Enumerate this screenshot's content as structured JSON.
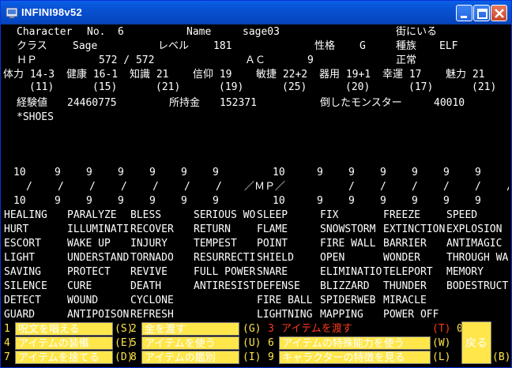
{
  "window": {
    "title": "INFINI98v52"
  },
  "char": {
    "row1": [
      "Character",
      "No.",
      "6",
      "Name",
      "sage03",
      "街にいる"
    ],
    "row2": [
      "クラス",
      "Sage",
      "レベル",
      "181",
      "性格",
      "G",
      "種族",
      "ELF"
    ],
    "row3": [
      "ＨＰ",
      "572 / 572",
      "ＡＣ",
      "9",
      "正常"
    ],
    "stats": [
      "体力 14-3",
      "健康 16-1",
      "知識 21",
      "信仰 19",
      "敏捷 22+2",
      "器用 19+1",
      "幸運 17",
      "魅力 21"
    ],
    "stats_sub": [
      "(11)",
      "(15)",
      "(21)",
      "(19)",
      "(25)",
      "(20)",
      "(17)",
      "(21)"
    ],
    "exp_label": "経験値",
    "exp": "24460775",
    "gold_label": "所持金",
    "gold": "152371",
    "kills_label": "倒したモンスター",
    "kills": "40010",
    "equip": "*SHOES"
  },
  "mp": {
    "top": [
      "10",
      "9",
      "9",
      "9",
      "9",
      "9",
      "9",
      "10",
      "9",
      "9",
      "9",
      "9",
      "9",
      "9"
    ],
    "slash_label": "／ＭＰ／",
    "bottom": [
      "10",
      "9",
      "9",
      "9",
      "9",
      "9",
      "9",
      "10",
      "9",
      "9",
      "9",
      "9",
      "9",
      "9"
    ]
  },
  "spells": [
    [
      "HEALING",
      "PARALYZE",
      "BLESS",
      "SERIOUS WO",
      "SLEEP",
      "FIX",
      "FREEZE",
      "SPEED"
    ],
    [
      "HURT",
      "ILLUMINATI",
      "RECOVER",
      "RETURN",
      "FLAME",
      "SNOWSTORM",
      "EXTINCTION",
      "EXPLOSION"
    ],
    [
      "ESCORT",
      "WAKE UP",
      "INJURY",
      "TEMPEST",
      "POINT",
      "FIRE WALL",
      "BARRIER",
      "ANTIMAGIC"
    ],
    [
      "LIGHT",
      "UNDERSTAND",
      "TORNADO",
      "RESURRECTI",
      "SHIELD",
      "OPEN",
      "WONDER",
      "THROUGH WA"
    ],
    [
      "SAVING",
      "PROTECT",
      "REVIVE",
      "FULL POWER",
      "SNARE",
      "ELIMINATIO",
      "TELEPORT",
      "MEMORY"
    ],
    [
      "SILENCE",
      "CURE",
      "DEATH",
      "ANTIRESIST",
      "DEFENSE",
      "BLIZZARD",
      "THUNDER",
      "BODESTRUCTIO"
    ],
    [
      "DETECT",
      "WOUND",
      "CYCLONE",
      "",
      "FIRE BALL",
      "SPIDERWEB",
      "MIRACLE",
      ""
    ],
    [
      "GUARD",
      "ANTIPOISON",
      "REFRESH",
      "",
      "LIGHTNING",
      "MAPPING",
      "POWER OFF",
      ""
    ]
  ],
  "menu": [
    {
      "num": "1",
      "label": "呪文を唱える",
      "key": "(S)"
    },
    {
      "num": "2",
      "label": "金を渡す",
      "key": "(G)"
    },
    {
      "num": "3",
      "label": "アイテムを渡す",
      "key": "(T)"
    },
    {
      "num": "4",
      "label": "アイテムの装備",
      "key": "(E)"
    },
    {
      "num": "5",
      "label": "アイテムを使う",
      "key": "(U)"
    },
    {
      "num": "6",
      "label": "アイテムの特殊能力を使う",
      "key": "(W)"
    },
    {
      "num": "7",
      "label": "アイテムを捨てる",
      "key": "(D)"
    },
    {
      "num": "8",
      "label": "アイテムの鑑別",
      "key": "(I)"
    },
    {
      "num": "9",
      "label": "キャラクターの特徴を見る",
      "key": "(L)"
    }
  ],
  "menu_extra": {
    "zero": "0",
    "back": "戻る",
    "back_key": "(B)"
  },
  "colors": {
    "accent": "#ffe64a",
    "disabled": "#ff3a1e",
    "titlebar": "#0850d0"
  }
}
